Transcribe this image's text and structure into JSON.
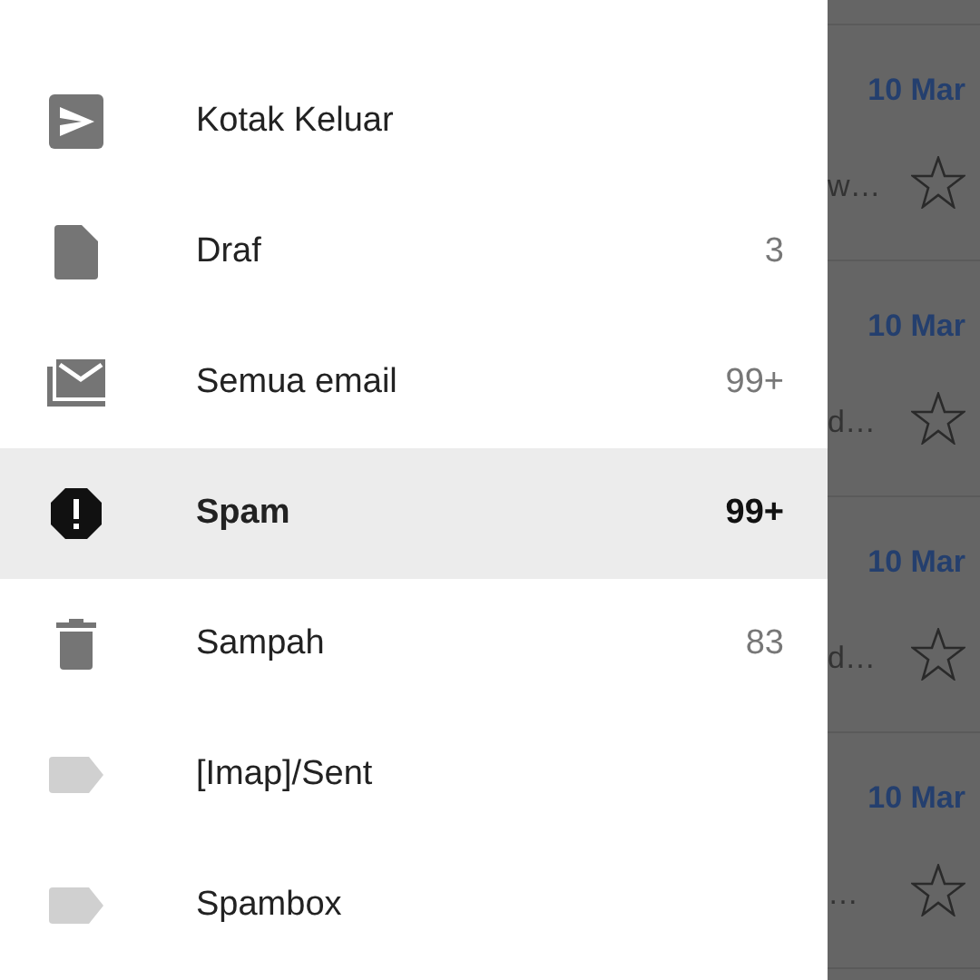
{
  "drawer": {
    "items": [
      {
        "kind": "outbox",
        "label": "Kotak Keluar",
        "selected": false
      },
      {
        "kind": "draft",
        "label": "Draf",
        "count": "3",
        "selected": false
      },
      {
        "kind": "all",
        "label": "Semua email",
        "count": "99+",
        "selected": false
      },
      {
        "kind": "spam",
        "label": "Spam",
        "count": "99+",
        "selected": true
      },
      {
        "kind": "trash",
        "label": "Sampah",
        "count": "83",
        "selected": false
      },
      {
        "kind": "label",
        "label": "[Imap]/Sent",
        "selected": false
      },
      {
        "kind": "label",
        "label": "Spambox",
        "selected": false
      }
    ]
  },
  "emails": [
    {
      "date": "10 Mar",
      "snippet": "w…",
      "starred": false
    },
    {
      "date": "10 Mar",
      "snippet": "d…",
      "starred": false
    },
    {
      "date": "10 Mar",
      "snippet": "d…",
      "starred": false
    },
    {
      "date": "10 Mar",
      "snippet": "…",
      "starred": false
    }
  ]
}
